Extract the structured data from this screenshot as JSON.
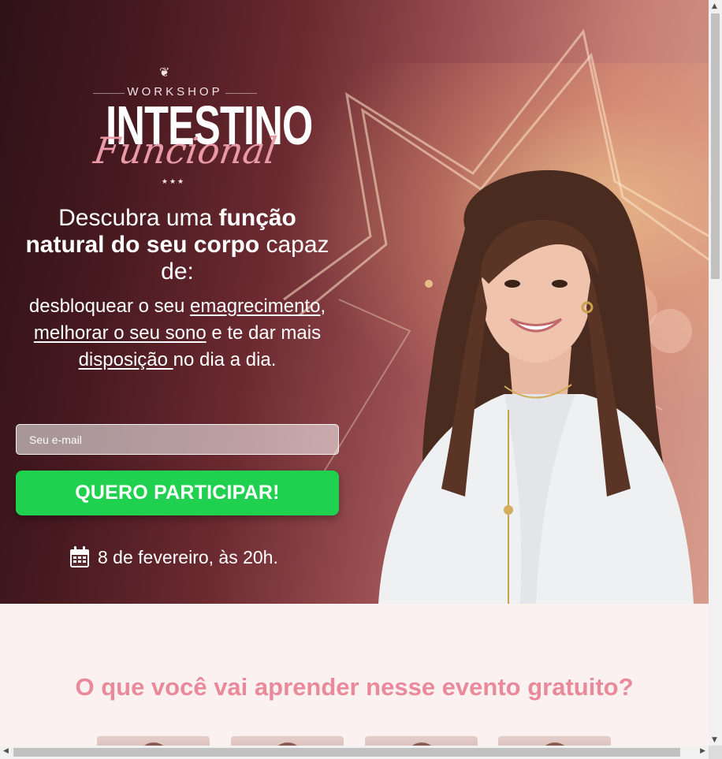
{
  "hero": {
    "brand": {
      "workshop": "WORKSHOP",
      "intestino": "INTESTINO",
      "funcional": "Funcional",
      "dots": "★★★"
    },
    "headline": {
      "part1": "Descubra uma ",
      "bold1": "função natural do seu corpo",
      "part2": " capaz de:"
    },
    "subline": {
      "t1": "desbloquear o seu ",
      "u1": "emagrecimento",
      "t2": ", ",
      "u2": "melhorar o seu sono",
      "t3": " e te dar mais ",
      "u3": "disposição ",
      "t4": "no dia a dia."
    },
    "email_placeholder": "Seu e-mail",
    "cta_label": "QUERO PARTICIPAR!",
    "date_text": "8 de fevereiro, às 20h.",
    "calendar_icon": "calendar-icon"
  },
  "learn": {
    "title": "O que você vai aprender nesse evento gratuito?"
  },
  "colors": {
    "cta": "#1fd14f",
    "accent_pink": "#e98a9a",
    "section_bg": "#fcf1f1"
  }
}
